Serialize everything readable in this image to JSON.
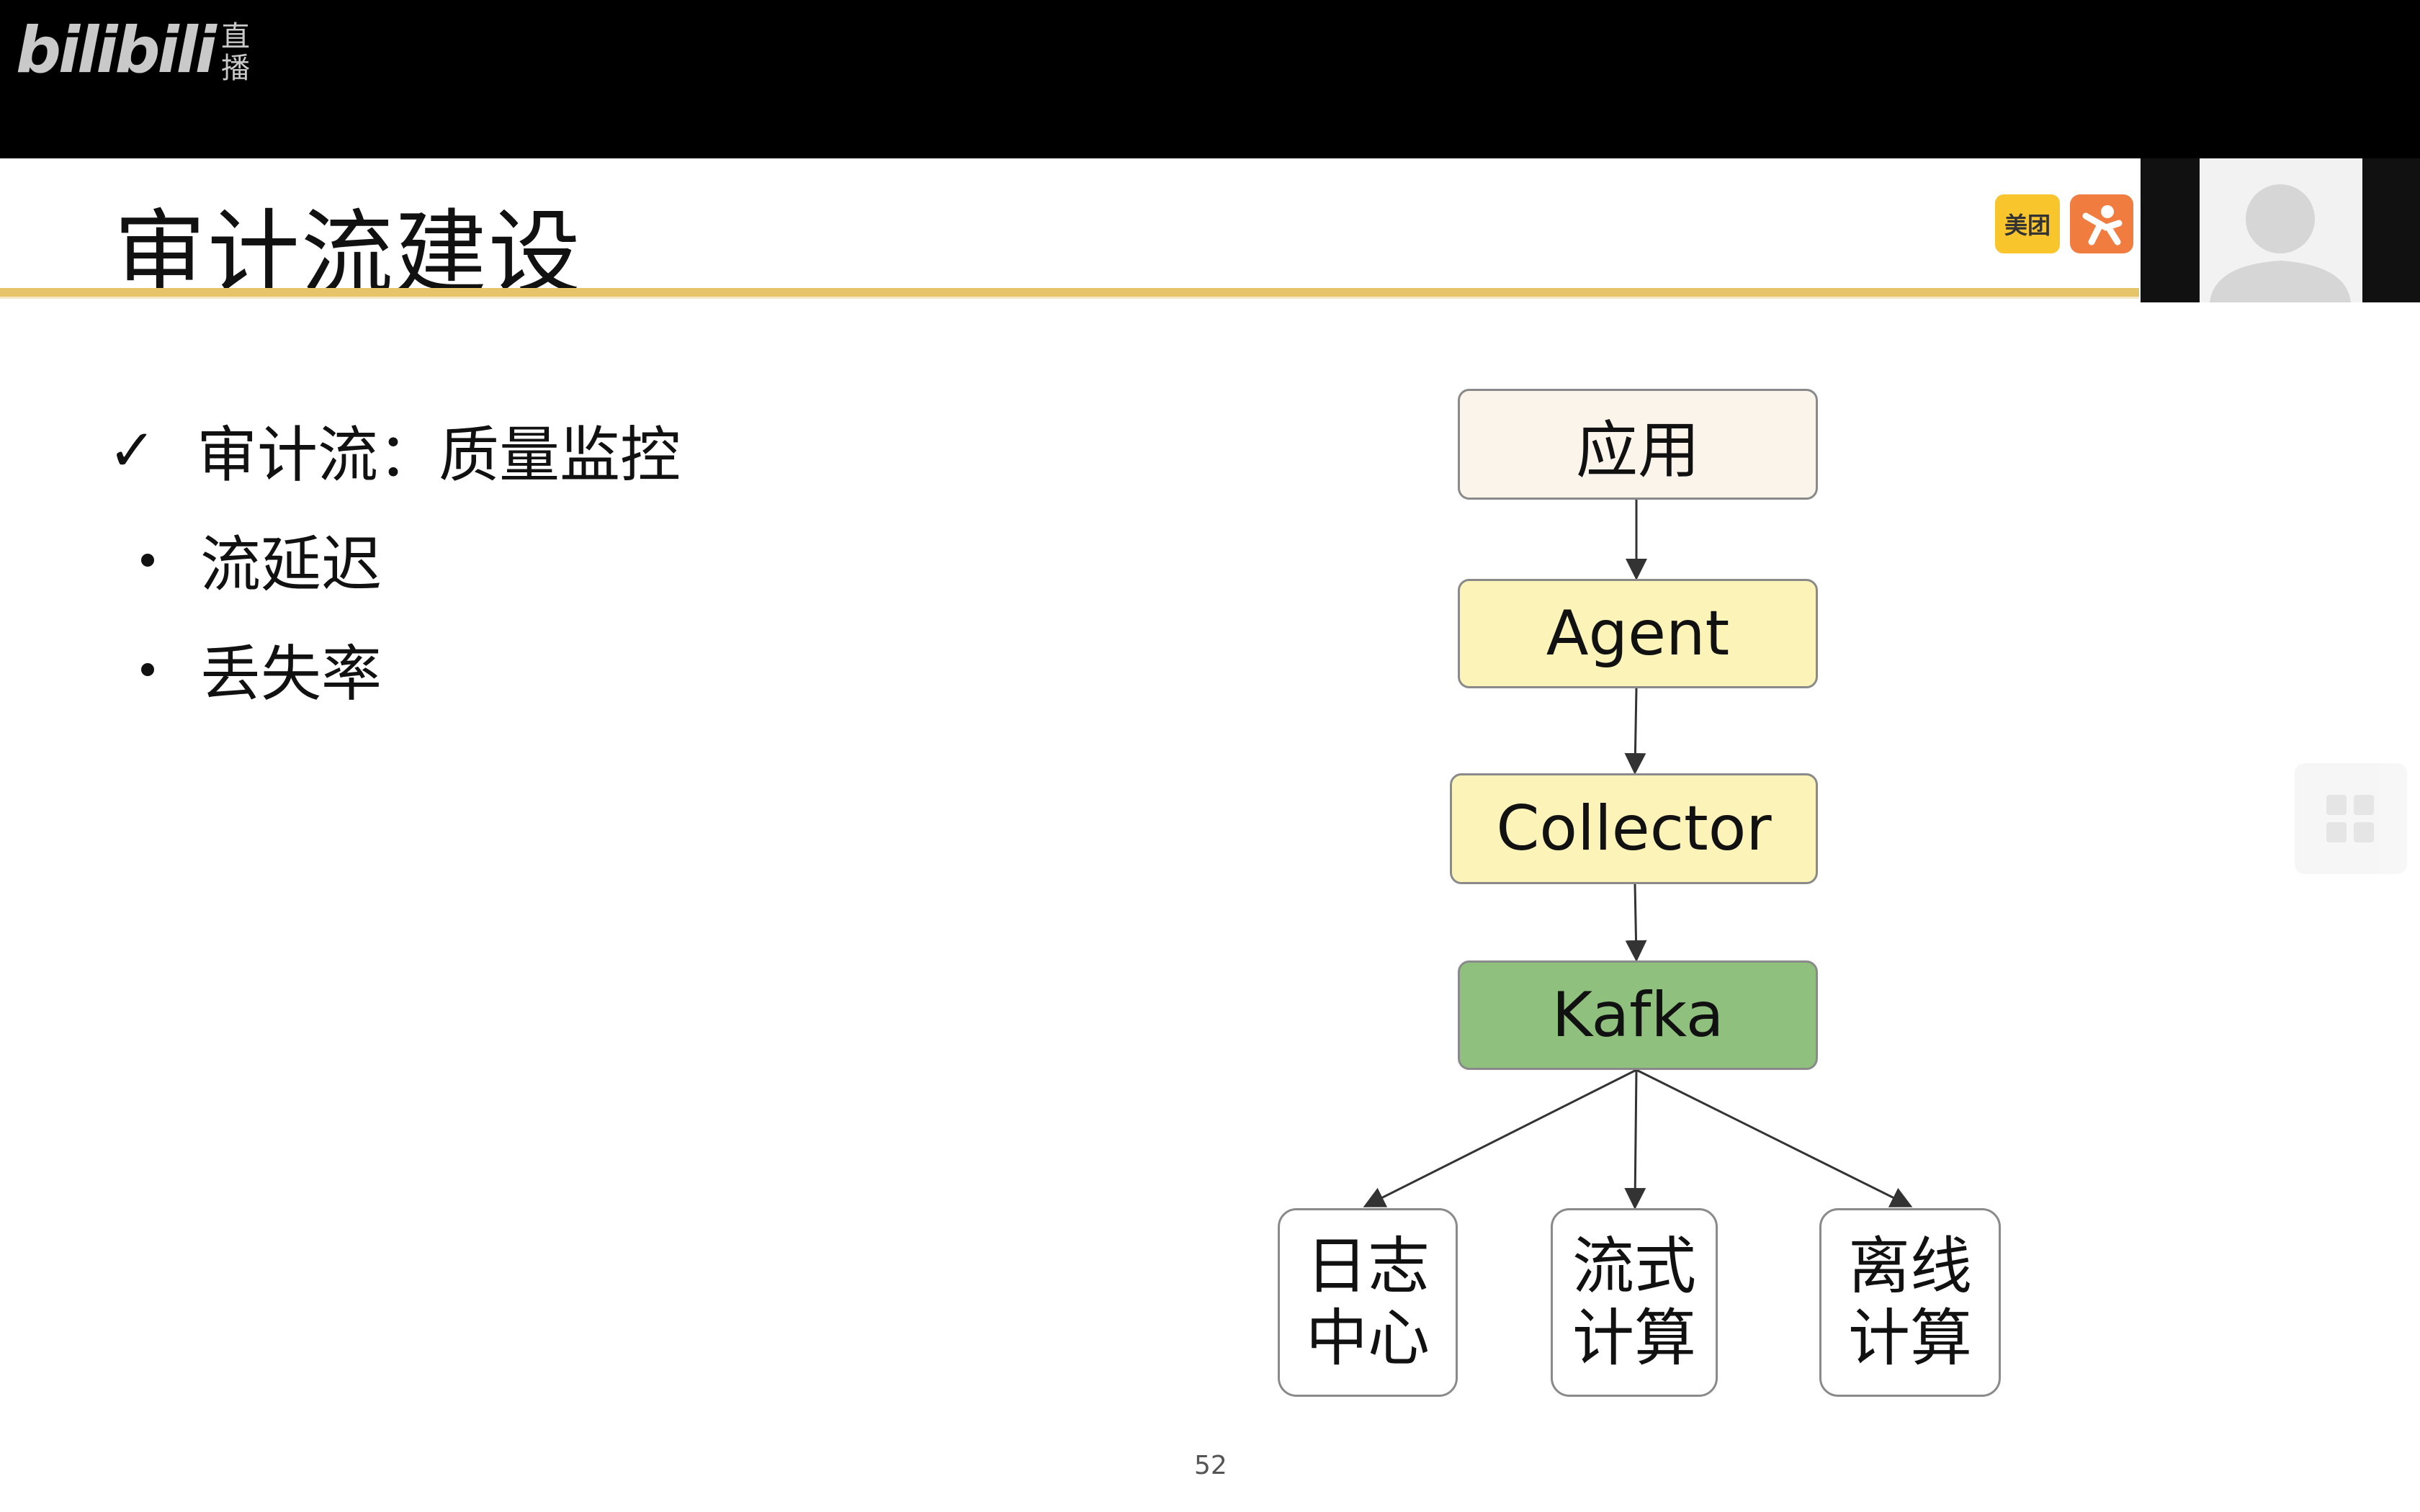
{
  "header": {
    "brand": "bilibili",
    "live_line1": "直",
    "live_line2": "播"
  },
  "slide": {
    "title": "审计流建设",
    "logo_meituan": "美团",
    "bullets": {
      "main": "审计流：质量监控",
      "subs": [
        "流延迟",
        "丢失率"
      ]
    },
    "diagram": {
      "nodes": {
        "app": "应用",
        "agent": "Agent",
        "collector": "Collector",
        "kafka": "Kafka"
      },
      "leaves": [
        {
          "line1": "日志",
          "line2": "中心"
        },
        {
          "line1": "流式",
          "line2": "计算"
        },
        {
          "line1": "离线",
          "line2": "计算"
        }
      ],
      "colors": {
        "app": "#fbf4ea",
        "agent": "#fbf3b8",
        "collector": "#fbf3b8",
        "kafka": "#8fc07d"
      }
    },
    "page_number": "52",
    "accent_color": "#e6c46a"
  }
}
